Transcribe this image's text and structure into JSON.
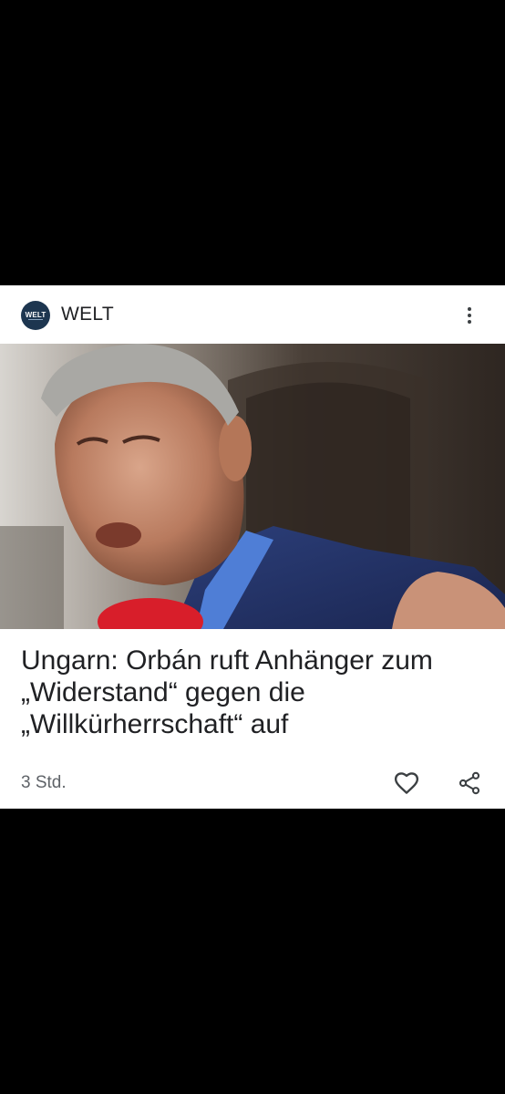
{
  "source": {
    "logo_text": "WELT",
    "name": "WELT"
  },
  "article": {
    "headline": "Ungarn: Orbán ruft Anhänger zum „Widerstand“ gegen die „Willkürherrschaft“ auf",
    "timestamp": "3 Std."
  },
  "icons": {
    "more": "more-vertical-icon",
    "like": "heart-icon",
    "share": "share-icon"
  },
  "colors": {
    "background": "#000000",
    "card": "#ffffff",
    "logo": "#1d3650",
    "text": "#202124",
    "muted": "#5f6368"
  }
}
